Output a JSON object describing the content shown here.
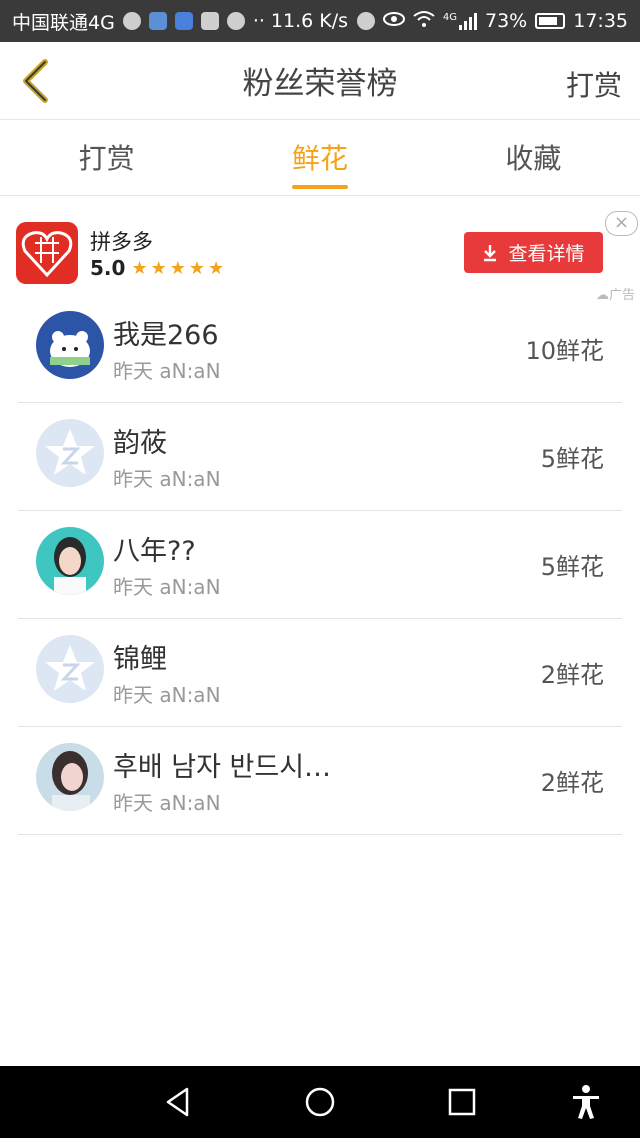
{
  "status_bar": {
    "carrier": "中国联通4G",
    "speed": "·· 11.6 K/s",
    "network": "4G",
    "battery": "73%",
    "time": "17:35"
  },
  "header": {
    "title": "粉丝荣誉榜",
    "action": "打赏"
  },
  "tabs": [
    {
      "label": "打赏",
      "active": false
    },
    {
      "label": "鲜花",
      "active": true
    },
    {
      "label": "收藏",
      "active": false
    }
  ],
  "ad": {
    "app_name": "拼多多",
    "rating": "5.0",
    "stars": "★★★★★",
    "button_label": "查看详情",
    "close_label": "×",
    "tag": "广告"
  },
  "fans": [
    {
      "name": "我是266",
      "time": "昨天 aN:aN",
      "count": "10鲜花",
      "avatar": "bear"
    },
    {
      "name": "韵莜",
      "time": "昨天 aN:aN",
      "count": "5鲜花",
      "avatar": "default"
    },
    {
      "name": "八年??",
      "time": "昨天 aN:aN",
      "count": "5鲜花",
      "avatar": "girl"
    },
    {
      "name": "锦鲤",
      "time": "昨天 aN:aN",
      "count": "2鲜花",
      "avatar": "default"
    },
    {
      "name": "후배 남자 반드시…",
      "time": "昨天 aN:aN",
      "count": "2鲜花",
      "avatar": "photo"
    }
  ],
  "colors": {
    "accent": "#f5a31a",
    "ad_button": "#e83a3a",
    "ad_logo": "#e02e24"
  }
}
